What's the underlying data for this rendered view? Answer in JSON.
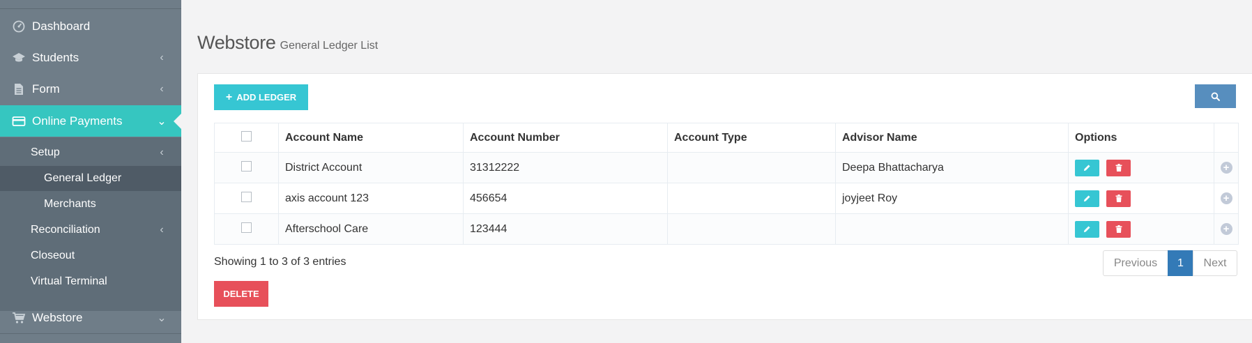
{
  "sidebar": {
    "items": [
      {
        "label": "Dashboard",
        "icon": "dashboard-icon"
      },
      {
        "label": "Students",
        "icon": "graduation-cap-icon"
      },
      {
        "label": "Form",
        "icon": "file-icon"
      },
      {
        "label": "Online Payments",
        "icon": "credit-card-icon"
      },
      {
        "label": "Webstore",
        "icon": "shopping-cart-icon"
      }
    ],
    "sub": [
      {
        "label": "Setup"
      },
      {
        "label": "General Ledger"
      },
      {
        "label": "Merchants"
      },
      {
        "label": "Reconciliation"
      },
      {
        "label": "Closeout"
      },
      {
        "label": "Virtual Terminal"
      }
    ]
  },
  "page": {
    "title": "Webstore",
    "subtitle": "General Ledger List"
  },
  "toolbar": {
    "add_label": "ADD LEDGER",
    "delete_label": "DELETE"
  },
  "table": {
    "columns": [
      "Account Name",
      "Account Number",
      "Account Type",
      "Advisor Name",
      "Options"
    ],
    "rows": [
      {
        "account_name": "District Account",
        "account_number": "31312222",
        "account_type": "",
        "advisor_name": "Deepa Bhattacharya"
      },
      {
        "account_name": "axis account 123",
        "account_number": "456654",
        "account_type": "",
        "advisor_name": "joyjeet Roy"
      },
      {
        "account_name": "Afterschool Care",
        "account_number": "123444",
        "account_type": "",
        "advisor_name": ""
      }
    ]
  },
  "footer": {
    "showing": "Showing 1 to 3 of 3 entries"
  },
  "pagination": {
    "previous": "Previous",
    "current": "1",
    "next": "Next"
  },
  "colors": {
    "sidebar_bg": "#6f7d88",
    "active_item": "#36c6c0",
    "primary_button": "#36c6d3",
    "danger_button": "#e7505a",
    "search_button": "#578ebe",
    "pager_active": "#337ab7"
  }
}
